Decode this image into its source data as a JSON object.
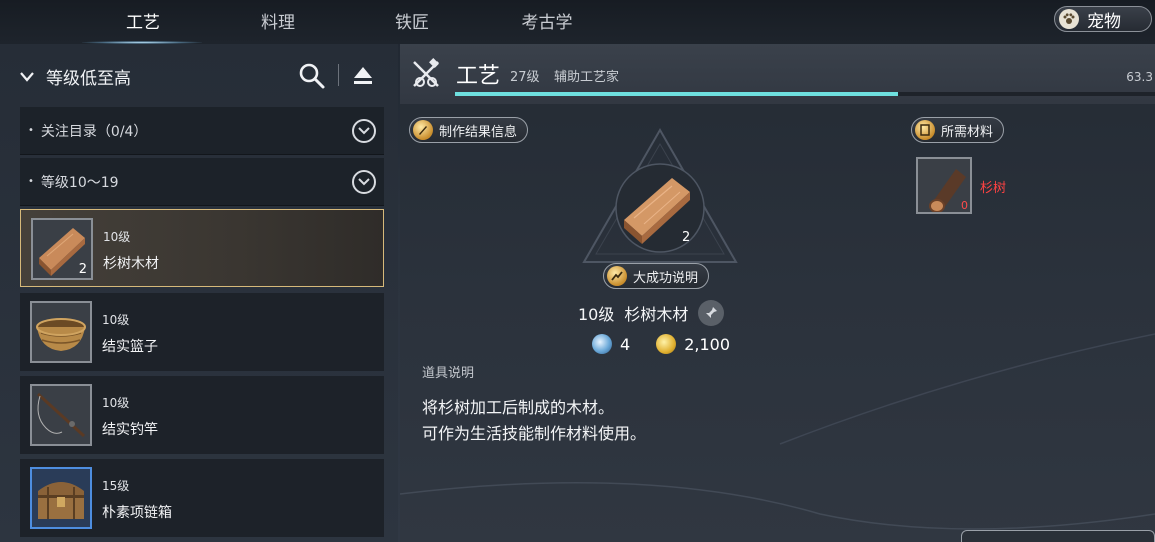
{
  "tabs": [
    {
      "label": "工艺",
      "active": true
    },
    {
      "label": "料理",
      "active": false
    },
    {
      "label": "铁匠",
      "active": false
    },
    {
      "label": "考古学",
      "active": false
    }
  ],
  "pet_button": {
    "label": "宠物",
    "icon": "paw-icon"
  },
  "sidebar": {
    "sort_label": "等级低至高",
    "groups": [
      {
        "label": "关注目录（0/4）"
      },
      {
        "label": "等级10～19"
      }
    ],
    "items": [
      {
        "level": "10级",
        "name": "杉树木材",
        "qty": "2",
        "selected": true,
        "icon": "wood-plank-icon"
      },
      {
        "level": "10级",
        "name": "结实篮子",
        "qty": "",
        "selected": false,
        "icon": "basket-icon"
      },
      {
        "level": "10级",
        "name": "结实钓竿",
        "qty": "",
        "selected": false,
        "icon": "fishing-rod-icon"
      },
      {
        "level": "15级",
        "name": "朴素项链箱",
        "qty": "",
        "selected": false,
        "icon": "chest-icon"
      }
    ]
  },
  "skill": {
    "name": "工艺",
    "level": "27级",
    "title": "辅助工艺家",
    "progress_text": "63.3",
    "progress_fraction": 0.633,
    "accent": "#6ee0df"
  },
  "result": {
    "info_label": "制作结果信息",
    "great_success_label": "大成功说明",
    "item_level": "10级",
    "item_name": "杉树木材",
    "qty": "2",
    "cost_points": "4",
    "cost_gold": "2,100",
    "desc_title": "道具说明",
    "desc_lines": [
      "将杉树加工后制成的木材。",
      "可作为生活技能制作材料使用。"
    ]
  },
  "materials": {
    "label": "所需材料",
    "items": [
      {
        "name": "杉树",
        "qty": "0",
        "color": "#ff4242"
      }
    ]
  }
}
